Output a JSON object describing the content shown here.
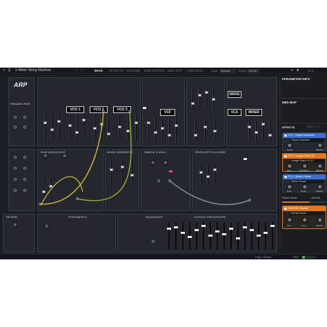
{
  "app": {
    "preset_name": "1-Meter String Machine",
    "tabs": [
      {
        "label": "MAIN",
        "active": true
      },
      {
        "label": "EFFECTS",
        "active": false
      },
      {
        "label": "REVERB",
        "active": false
      },
      {
        "label": "MOD MATRIX",
        "active": false
      },
      {
        "label": "MIDI MAP",
        "active": false
      },
      {
        "label": "LIBRARIAN",
        "active": false
      }
    ],
    "sync_label": "Sync",
    "sync_value": "Internal",
    "tempo_label": "Tempo",
    "tempo_value": "120.00",
    "zoom_value": "4 / 4",
    "logo_text": "ARP"
  },
  "panel": {
    "modules": {
      "preamplifier": "PREAMPLIFIER",
      "vco1": "VCO 1",
      "vco2": "VCO 2",
      "vco3": "VCO 3",
      "vcf": "VCF",
      "vca": "VCA",
      "drive": "DRIVE",
      "mixer": "MIXER",
      "sample_hold": "SAMPLE & HOLD",
      "noise_generator": "NOISE GENERATOR",
      "ring_modulator": "RING MODULATOR",
      "envelope_follower": "ENVELOPE FOLLOWER",
      "reverb": "REVERB",
      "portamento": "PORTAMENTO",
      "sequencer": "SEQUENCER",
      "voltage_processors": "VOLTAGE PROCESSORS"
    }
  },
  "side": {
    "parameter_info_title": "PARAMETER INFO",
    "midi_map_title": "MIDI MAP",
    "effects_tab": "EFFECTS",
    "fast_fx_tab": "TEMP FX TS",
    "fx_slots": [
      {
        "index": "FX 1",
        "name": "Polysix Ensemble",
        "preset": "Polysix Ensemble",
        "color": "#3c6fd0",
        "knobs": [
          "Depth",
          "Wet/Dry"
        ]
      },
      {
        "index": "FX 2",
        "name": "Orange Phase V2",
        "preset": "Orange Phase V2 V2",
        "color": "#e2771e",
        "knobs": [
          "Rate",
          "Feedback",
          "Wet/Dry"
        ]
      },
      {
        "index": "FX 3",
        "name": "Stereo Chorus",
        "preset": "Stereo Chorus",
        "color": "#3c6fd0",
        "knobs": [
          "Rate",
          "Depth",
          "Wet/Dry"
        ]
      }
    ],
    "reverb_send_label": "Reverb Send",
    "reverb_send_value": "-12.6 dB",
    "reverb": {
      "title": "REVERB",
      "algo": "Shared",
      "preset": "Mid and Small",
      "color": "#e2771e",
      "knobs": [
        "Size",
        "Time",
        "Wet/Dry"
      ]
    }
  },
  "bottom": {
    "poly_label": "Poly 4 Voices",
    "cpu_label": "CPU"
  },
  "colors": {
    "cable_yellow": "#c8b43a",
    "cable_olive": "#9aa53a",
    "cable_gray": "#8a8f96",
    "accent_blue": "#3c6fd0",
    "accent_orange": "#e2771e"
  }
}
